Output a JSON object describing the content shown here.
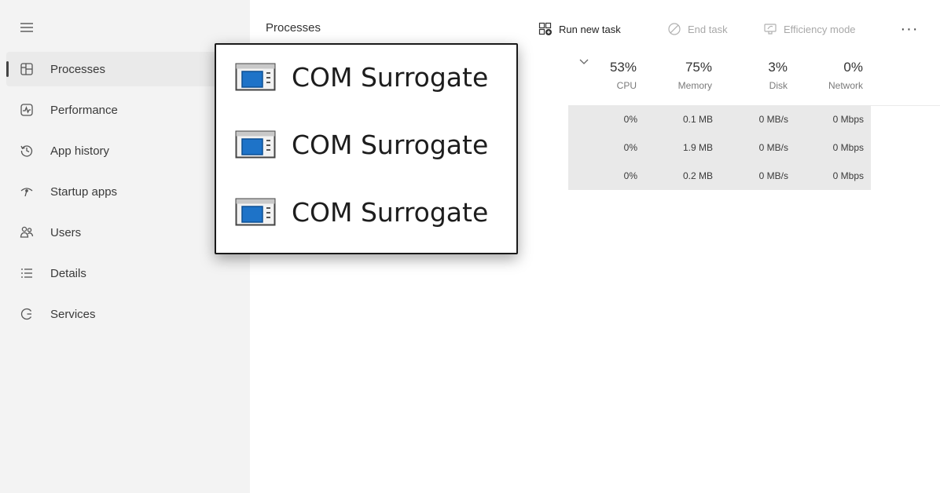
{
  "sidebar": {
    "menu_icon": "hamburger-icon",
    "items": [
      {
        "label": "Processes",
        "icon": "processes-icon",
        "active": true
      },
      {
        "label": "Performance",
        "icon": "performance-icon"
      },
      {
        "label": "App history",
        "icon": "history-icon"
      },
      {
        "label": "Startup apps",
        "icon": "startup-icon"
      },
      {
        "label": "Users",
        "icon": "users-icon"
      },
      {
        "label": "Details",
        "icon": "details-icon"
      },
      {
        "label": "Services",
        "icon": "services-icon"
      }
    ]
  },
  "toolbar": {
    "title": "Processes",
    "run_new_task": "Run new task",
    "end_task": "End task",
    "efficiency_mode": "Efficiency mode",
    "more": "···"
  },
  "columns": [
    {
      "percent": "53%",
      "label": "CPU"
    },
    {
      "percent": "75%",
      "label": "Memory"
    },
    {
      "percent": "3%",
      "label": "Disk"
    },
    {
      "percent": "0%",
      "label": "Network"
    }
  ],
  "rows": [
    {
      "cpu": "0%",
      "memory": "0.1 MB",
      "disk": "0 MB/s",
      "network": "0 Mbps"
    },
    {
      "cpu": "0%",
      "memory": "1.9 MB",
      "disk": "0 MB/s",
      "network": "0 Mbps"
    },
    {
      "cpu": "0%",
      "memory": "0.2 MB",
      "disk": "0 MB/s",
      "network": "0 Mbps"
    }
  ],
  "popup": {
    "items": [
      {
        "name": "COM Surrogate",
        "icon": "app-window-icon"
      },
      {
        "name": "COM Surrogate",
        "icon": "app-window-icon"
      },
      {
        "name": "COM Surrogate",
        "icon": "app-window-icon"
      }
    ]
  },
  "colors": {
    "sidebar_bg": "#f3f3f3",
    "grid_highlight": "#e9e9e9",
    "app_icon_blue": "#1e73c8"
  }
}
